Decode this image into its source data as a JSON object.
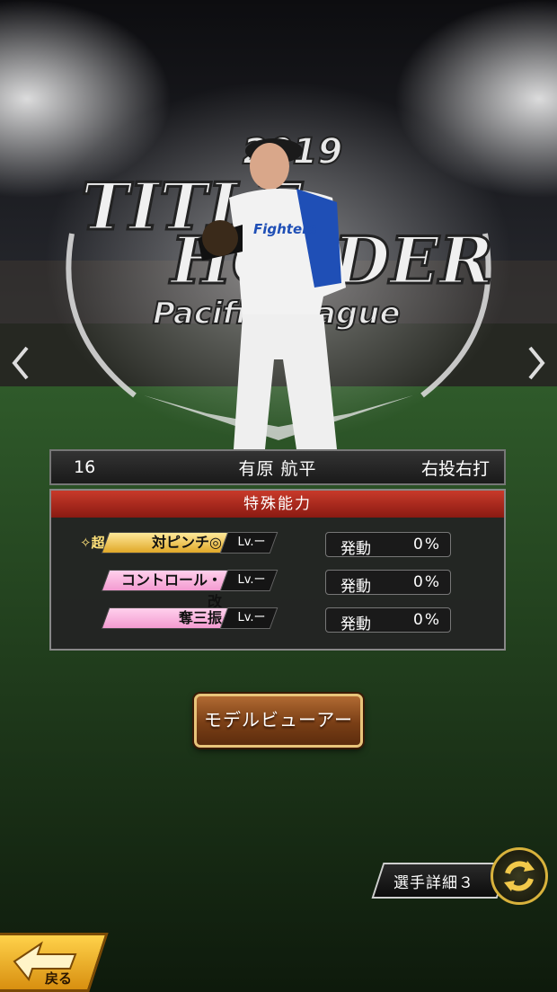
{
  "title_emblem": {
    "year": "2019",
    "line1": "TITLE",
    "line2": "HOLDER",
    "line3": "Pacific League"
  },
  "player": {
    "number": "16",
    "name": "有原 航平",
    "handedness": "右投右打",
    "team_jersey": "Fighters"
  },
  "abilities": {
    "header": "特殊能力",
    "items": [
      {
        "super": "✧超",
        "name": "対ピンチ◎",
        "level": "Lv.ー",
        "trigger_label": "発動",
        "trigger_value": "0%",
        "style": "gold"
      },
      {
        "super": "",
        "name": "コントロール・改",
        "level": "Lv.ー",
        "trigger_label": "発動",
        "trigger_value": "0%",
        "style": "pink"
      },
      {
        "super": "",
        "name": "奪三振",
        "level": "Lv.ー",
        "trigger_label": "発動",
        "trigger_value": "0%",
        "style": "pink"
      }
    ]
  },
  "buttons": {
    "model_viewer": "モデルビューアー",
    "player_detail": "選手詳細３",
    "back": "戻る"
  },
  "icons": {
    "prev": "chevron-left-icon",
    "next": "chevron-right-icon",
    "swap": "swap-arrows-icon",
    "back": "back-arrow-icon"
  },
  "colors": {
    "ability_header": "#b5291c",
    "gold_tag": "#f2c04a",
    "pink_tag": "#f6a8d8",
    "model_button": "#8a4a1c",
    "back_button": "#f2b526"
  }
}
